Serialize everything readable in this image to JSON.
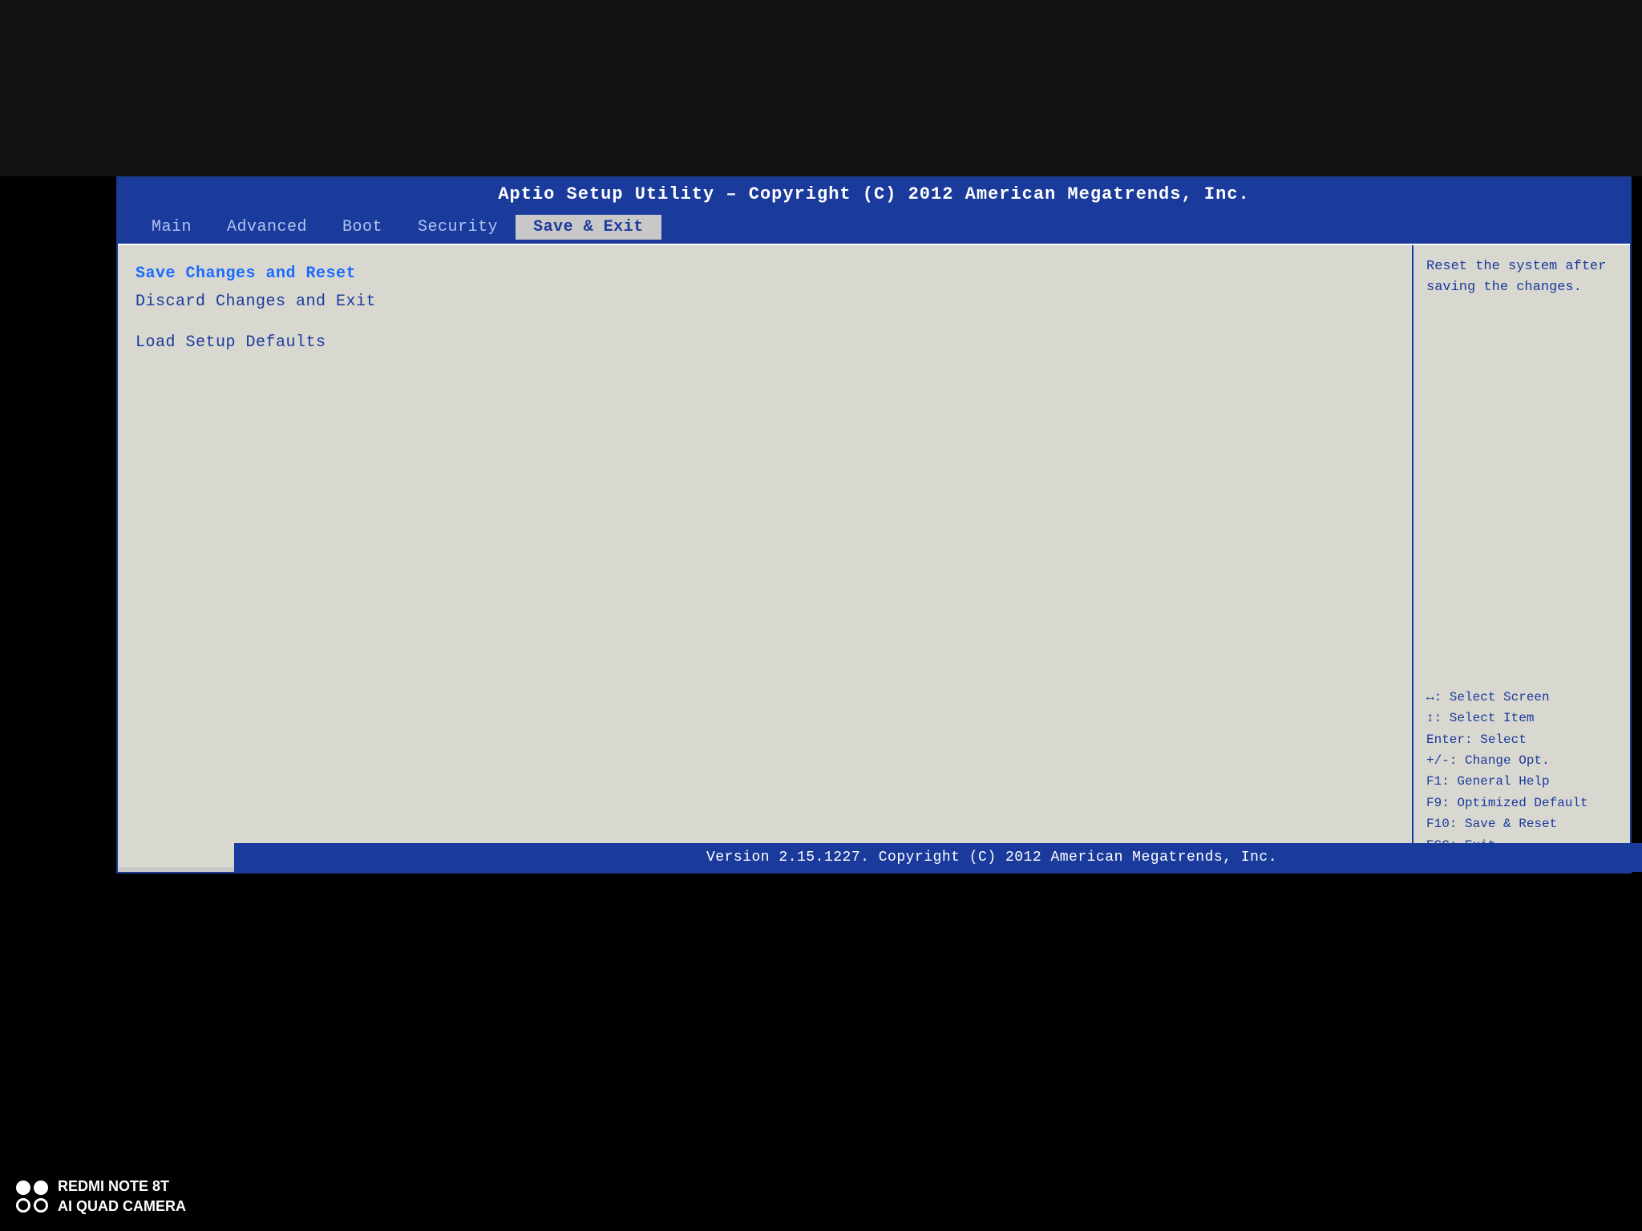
{
  "bios": {
    "title": "Aptio Setup Utility – Copyright (C) 2012 American Megatrends, Inc.",
    "version_bar": "Version 2.15.1227. Copyright (C) 2012 American Megatrends, Inc.",
    "menu": {
      "items": [
        {
          "label": "Main",
          "active": false
        },
        {
          "label": "Advanced",
          "active": false
        },
        {
          "label": "Boot",
          "active": false
        },
        {
          "label": "Security",
          "active": false
        },
        {
          "label": "Save & Exit",
          "active": true
        }
      ]
    },
    "options": [
      {
        "label": "Save Changes and Reset",
        "selected": true
      },
      {
        "label": "Discard Changes and Exit",
        "selected": false
      },
      {
        "label": "",
        "gap": true
      },
      {
        "label": "Load Setup Defaults",
        "selected": false
      }
    ],
    "help": {
      "description": "Reset the system after saving the changes.",
      "keys": [
        "↔: Select Screen",
        "↕: Select Item",
        "Enter: Select",
        "+/-: Change Opt.",
        "F1: General Help",
        "F9: Optimized Default",
        "F10: Save & Reset",
        "ESC: Exit"
      ]
    }
  },
  "watermark": {
    "device": "REDMI NOTE 8T",
    "camera": "AI QUAD CAMERA"
  }
}
